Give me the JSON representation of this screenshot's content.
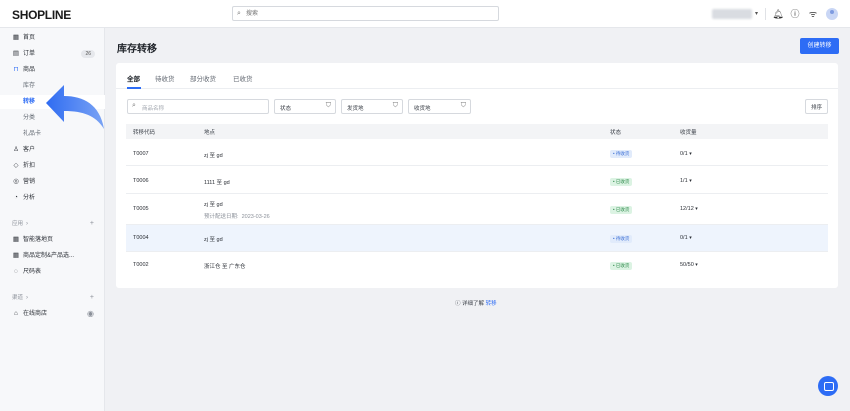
{
  "header": {
    "logo": "SHOPLINE",
    "search_placeholder": "搜索",
    "icons": [
      "bell-icon",
      "help-icon",
      "wifi-icon",
      "user-avatar-icon"
    ]
  },
  "sidebar": {
    "items": [
      {
        "label": "首页",
        "icon": "home-icon"
      },
      {
        "label": "订单",
        "icon": "order-icon",
        "badge": "26"
      },
      {
        "label": "商品",
        "icon": "bag-icon"
      },
      {
        "label": "库存"
      },
      {
        "label": "转移"
      },
      {
        "label": "分类"
      },
      {
        "label": "礼品卡"
      },
      {
        "label": "客户",
        "icon": "user-icon"
      },
      {
        "label": "折扣",
        "icon": "tag-icon"
      },
      {
        "label": "营销",
        "icon": "target-icon"
      },
      {
        "label": "分析",
        "icon": "chart-icon"
      }
    ],
    "apps_section": "应用",
    "apps": [
      {
        "label": "智能落地页",
        "icon": "grid-icon"
      },
      {
        "label": "商品定制&产品选...",
        "icon": "grid-icon"
      },
      {
        "label": "尺码表",
        "icon": "circle-icon"
      }
    ],
    "channels_section": "渠道",
    "channels": [
      {
        "label": "在线商店",
        "icon": "store-icon"
      }
    ]
  },
  "page": {
    "title": "库存转移",
    "create_button": "创建转移",
    "tabs": [
      "全部",
      "待收货",
      "部分收货",
      "已收货"
    ],
    "search_placeholder": "商品名称",
    "filters": [
      "状态",
      "发货地",
      "收货地"
    ],
    "sort_button": "排序",
    "columns": [
      "转移代码",
      "地点",
      "状态",
      "收货量"
    ],
    "rows": [
      {
        "code": "T0007",
        "location": "zj 至 gd",
        "status": "待收货",
        "qty": "0/1"
      },
      {
        "code": "T0006",
        "location": "1111 至 gd",
        "status": "已收货",
        "qty": "1/1"
      },
      {
        "code": "T0005",
        "location": "zj 至 gd",
        "sub_label": "预计配送日期",
        "sub_value": "2023-03-26",
        "status": "已收货",
        "qty": "12/12"
      },
      {
        "code": "T0004",
        "location": "zj 至 gd",
        "status": "待收货",
        "qty": "0/1"
      },
      {
        "code": "T0002",
        "location": "浙江仓 至 广东仓",
        "status": "已收货",
        "qty": "50/50"
      }
    ],
    "footer_prefix": "详细了解",
    "footer_link": "转移"
  },
  "colors": {
    "accent": "#2d6cf5",
    "pending_bg": "#e1ebfb",
    "received_bg": "#dcf3e3"
  }
}
